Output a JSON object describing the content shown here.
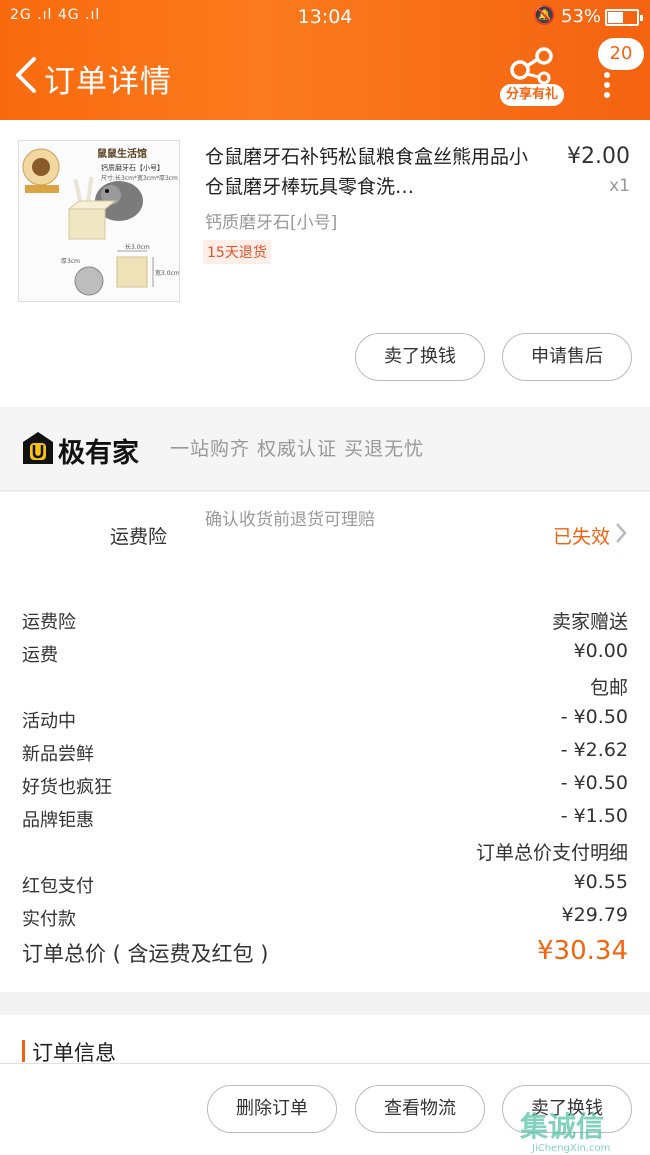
{
  "status_bar": {
    "signal": "2G .ıl 4G .ıl",
    "time": "13:04",
    "battery": "53%"
  },
  "header": {
    "title": "订单详情",
    "share_label": "分享有礼",
    "message_count": "20"
  },
  "product": {
    "image_texts": {
      "shop": "鼠鼠生活馆",
      "product": "钙质磨牙石【小号】",
      "size": "尺寸:长3cm*宽3cm*厚3cm",
      "length": "长3.0cm",
      "width": "宽3.0cm",
      "thickness": "厚3cm"
    },
    "name": "仓鼠磨牙石补钙松鼠粮食盒丝熊用品小仓鼠磨牙棒玩具零食洗…",
    "sku": "钙质磨牙石[小号]",
    "tag": "15天退货",
    "price": "¥2.00",
    "qty": "x1"
  },
  "product_actions": {
    "buy_shipping": "卖了换钱",
    "after_sales": "申请售后"
  },
  "brand": {
    "logo_letter": "U",
    "name": "极有家",
    "slogan": "一站购齐  权威认证  买退无忧"
  },
  "insurance": {
    "label": "运费险",
    "description": "确认收货前退货可理赔",
    "status": "已失效"
  },
  "price_rows": [
    {
      "label": "运费险",
      "value": "卖家赠送"
    },
    {
      "label": "运费",
      "value": "¥0.00"
    },
    {
      "label": "",
      "value": "包邮"
    },
    {
      "label": "活动中",
      "value": "- ¥0.50"
    },
    {
      "label": "新品尝鲜",
      "value": "- ¥2.62"
    },
    {
      "label": "好货也疯狂",
      "value": "- ¥0.50"
    },
    {
      "label": "品牌钜惠",
      "value": "- ¥1.50"
    },
    {
      "label": "",
      "value": "订单总价支付明细"
    },
    {
      "label": "红包支付",
      "value": "¥0.55"
    },
    {
      "label": "实付款",
      "value": "¥29.79"
    }
  ],
  "total": {
    "label": "订单总价 ( 含运费及红包 )",
    "value": "¥30.34"
  },
  "order_info": {
    "title": "订单信息"
  },
  "bottom_actions": {
    "delete": "删除订单",
    "logistics": "查看物流",
    "sell": "卖了换钱"
  },
  "watermark": {
    "text": "集诚信",
    "url": "JiChengXin.com"
  },
  "colors": {
    "accent": "#f5630f",
    "header_gradient_start": "#f96a0e",
    "header_gradient_end": "#f46310"
  }
}
